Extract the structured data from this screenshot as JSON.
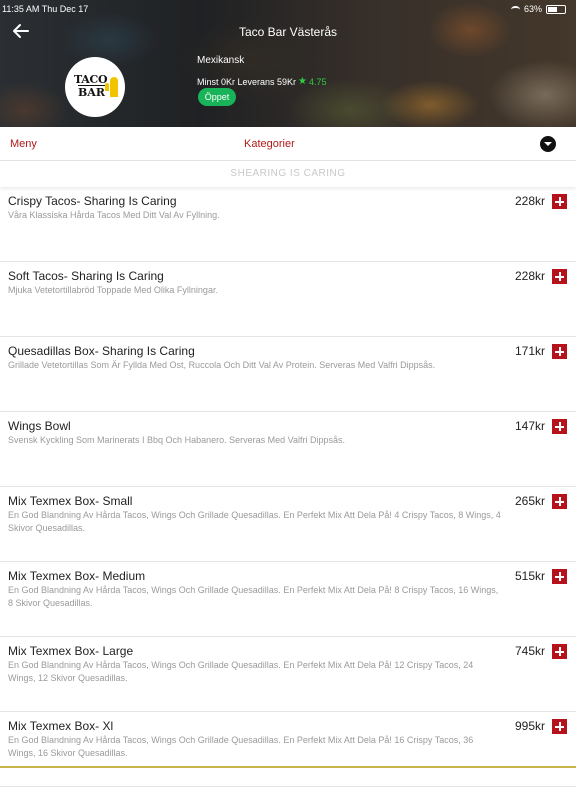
{
  "status_bar": {
    "time": "11:35 AM  Thu Dec 17",
    "battery": "63%"
  },
  "header": {
    "title": "Taco Bar Västerås",
    "logo_text_top": "TACO",
    "logo_text_bottom": "BAR",
    "cuisine": "Mexikansk",
    "delivery_info": "Minst 0Kr Leverans 59Kr",
    "rating": "4.75",
    "open_status": "Öppet"
  },
  "nav": {
    "menu_label": "Meny",
    "categories_label": "Kategorier"
  },
  "section_title": "SHEARING IS CARING",
  "items": [
    {
      "name": "Crispy Tacos- Sharing Is Caring",
      "description": "Våra Klassiska Hårda Tacos Med Ditt Val Av Fyllning.",
      "price": "228kr"
    },
    {
      "name": "Soft Tacos- Sharing Is Caring",
      "description": "Mjuka Vetetortillabröd Toppade Med Olika Fyllningar.",
      "price": "228kr"
    },
    {
      "name": "Quesadillas Box- Sharing Is Caring",
      "description": "Grillade Vetetortillas Som Är Fyllda Med Ost, Ruccola Och Ditt Val Av Protein. Serveras Med Valfri Dippsås.",
      "price": "171kr"
    },
    {
      "name": "Wings Bowl",
      "description": "Svensk Kyckling Som Marinerats I Bbq Och Habanero. Serveras Med Valfri Dippsås.",
      "price": "147kr"
    },
    {
      "name": "Mix Texmex Box- Small",
      "description": "En God Blandning Av Hårda Tacos, Wings Och Grillade Quesadillas. En Perfekt Mix Att Dela På! 4 Crispy Tacos, 8 Wings, 4 Skivor Quesadillas.",
      "price": "265kr"
    },
    {
      "name": "Mix Texmex Box- Medium",
      "description": "En God Blandning Av Hårda Tacos, Wings Och Grillade Quesadillas. En Perfekt Mix Att Dela På! 8 Crispy Tacos, 16 Wings, 8 Skivor Quesadillas.",
      "price": "515kr"
    },
    {
      "name": "Mix Texmex Box- Large",
      "description": "En God Blandning Av Hårda Tacos, Wings Och Grillade Quesadillas. En Perfekt Mix Att Dela På! 12 Crispy Tacos, 24 Wings, 12 Skivor Quesadillas.",
      "price": "745kr"
    },
    {
      "name": "Mix Texmex Box- Xl",
      "description": "En God Blandning Av Hårda Tacos, Wings Och Grillade Quesadillas. En Perfekt Mix Att Dela På! 16 Crispy Tacos, 36 Wings, 16 Skivor Quesadillas.",
      "price": "995kr"
    }
  ],
  "colors": {
    "accent_red": "#b5121b",
    "tab_red": "#b01a1a",
    "open_green": "#19b35a",
    "rating_green": "#2ecc40"
  },
  "icons": {
    "back": "arrow-left-icon",
    "dropdown": "chevron-down-icon",
    "add": "plus-icon",
    "rating": "star-icon"
  }
}
